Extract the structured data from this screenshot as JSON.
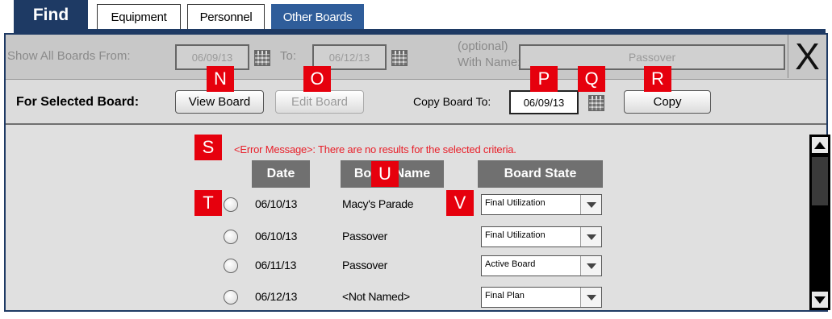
{
  "tabs": {
    "find": "Find",
    "items": [
      {
        "label": "Equipment"
      },
      {
        "label": "Personnel"
      },
      {
        "label": "Other Boards"
      }
    ]
  },
  "filter": {
    "show_from_label": "Show All Boards From:",
    "from_date": "06/09/13",
    "to_label": "To:",
    "to_date": "06/12/13",
    "optional_label": "(optional)",
    "with_name_label": "With Name:",
    "name_value": "Passover",
    "close_glyph": "X"
  },
  "actions": {
    "for_selected_label": "For Selected Board:",
    "view_board": "View Board",
    "edit_board": "Edit Board",
    "copy_to_label": "Copy Board To:",
    "copy_date": "06/09/13",
    "copy_button": "Copy"
  },
  "callouts": [
    "N",
    "O",
    "P",
    "Q",
    "R",
    "S",
    "T",
    "U",
    "V"
  ],
  "error": {
    "prefix": "<Error Message>:",
    "text": "There are no results for the selected criteria."
  },
  "table": {
    "headers": [
      "Date",
      "Board Name",
      "Board State"
    ],
    "rows": [
      {
        "date": "06/10/13",
        "name": "Macy's Parade",
        "state": "Final Utilization"
      },
      {
        "date": "06/10/13",
        "name": "Passover",
        "state": "Final Utilization"
      },
      {
        "date": "06/11/13",
        "name": "Passover",
        "state": "Active Board"
      },
      {
        "date": "06/12/13",
        "name": "<Not Named>",
        "state": "Final Plan"
      }
    ]
  },
  "colors": {
    "accent": "#1e3a64",
    "active_tab": "#2f5d9a",
    "marker": "#e6000d",
    "error": "#e8202a",
    "header": "#707070"
  }
}
